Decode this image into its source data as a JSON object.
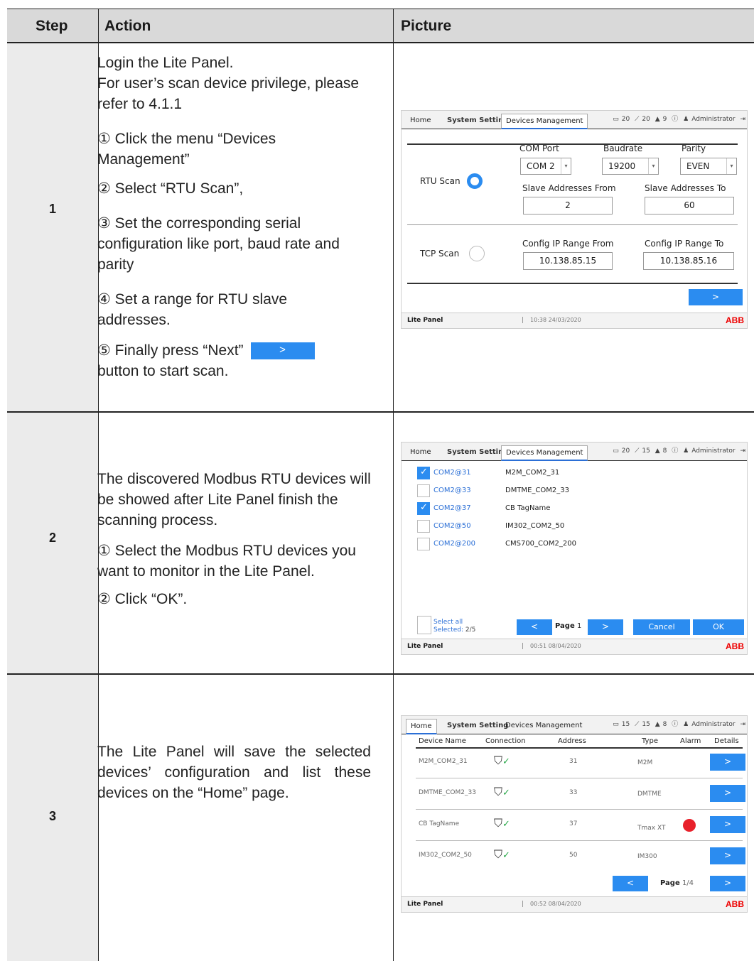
{
  "header": {
    "step": "Step",
    "action": "Action",
    "picture": "Picture"
  },
  "rows": [
    {
      "step": "1",
      "lines": [
        "Login the Lite Panel.",
        "For user’s scan device privilege, please refer to 4.1.1",
        "① Click the menu “Devices Management”",
        "② Select “RTU Scan”,",
        "③ Set the corresponding serial configuration like port, baud rate and parity",
        "④ Set a range for RTU slave addresses.",
        "⑤ Finally press “Next”",
        "button to start scan."
      ],
      "inline_button": ">"
    },
    {
      "step": "2",
      "lines": [
        "The discovered Modbus RTU devices will be showed after Lite Panel finish the scanning process.",
        "① Select the Modbus RTU devices you want to monitor in the Lite Panel.",
        "② Click “OK”."
      ]
    },
    {
      "step": "3",
      "lines": [
        "The Lite Panel will save the selected devices’ configuration and list these devices on the “Home” page."
      ]
    }
  ],
  "panel": {
    "tabs": [
      "Home",
      "System Setting",
      "Devices Management"
    ],
    "user": "Administrator",
    "footer_name": "Lite Panel",
    "brand": "ABB"
  },
  "shot1": {
    "status": [
      "20",
      "20",
      "9"
    ],
    "com_port_label": "COM Port",
    "com_port": "COM 2",
    "baud_label": "Baudrate",
    "baud": "19200",
    "parity_label": "Parity",
    "parity": "EVEN",
    "rtu_scan": "RTU Scan",
    "tcp_scan": "TCP Scan",
    "slave_from_label": "Slave Addresses From",
    "slave_from": "2",
    "slave_to_label": "Slave Addresses To",
    "slave_to": "60",
    "ip_from_label": "Config IP Range From",
    "ip_from": "10.138.85.15",
    "ip_to_label": "Config IP Range To",
    "ip_to": "10.138.85.16",
    "next": ">",
    "time": "10:38 24/03/2020"
  },
  "shot2": {
    "status": [
      "20",
      "15",
      "8"
    ],
    "devices": [
      {
        "id": "COM2@31",
        "name": "M2M_COM2_31",
        "checked": true
      },
      {
        "id": "COM2@33",
        "name": "DMTME_COM2_33",
        "checked": false
      },
      {
        "id": "COM2@37",
        "name": "CB TagName",
        "checked": true
      },
      {
        "id": "COM2@50",
        "name": "IM302_COM2_50",
        "checked": false
      },
      {
        "id": "COM2@200",
        "name": "CMS700_COM2_200",
        "checked": false
      }
    ],
    "select_all": "Select all",
    "selected_label": "Selected:",
    "selected": "2/5",
    "prev": "<",
    "page_label": "Page",
    "page": "1",
    "next": ">",
    "cancel": "Cancel",
    "ok": "OK",
    "time": "00:51 08/04/2020"
  },
  "shot3": {
    "status": [
      "15",
      "15",
      "8"
    ],
    "columns": [
      "Device Name",
      "Connection",
      "Address",
      "Type",
      "Alarm",
      "Details"
    ],
    "devices": [
      {
        "name": "M2M_COM2_31",
        "address": "31",
        "type": "M2M",
        "alarm": false
      },
      {
        "name": "DMTME_COM2_33",
        "address": "33",
        "type": "DMTME",
        "alarm": false
      },
      {
        "name": "CB TagName",
        "address": "37",
        "type": "Tmax XT",
        "alarm": true
      },
      {
        "name": "IM302_COM2_50",
        "address": "50",
        "type": "IM300",
        "alarm": false
      }
    ],
    "details_btn": ">",
    "prev": "<",
    "page_label": "Page",
    "page": "1/4",
    "next": ">",
    "time": "00:52 08/04/2020"
  }
}
